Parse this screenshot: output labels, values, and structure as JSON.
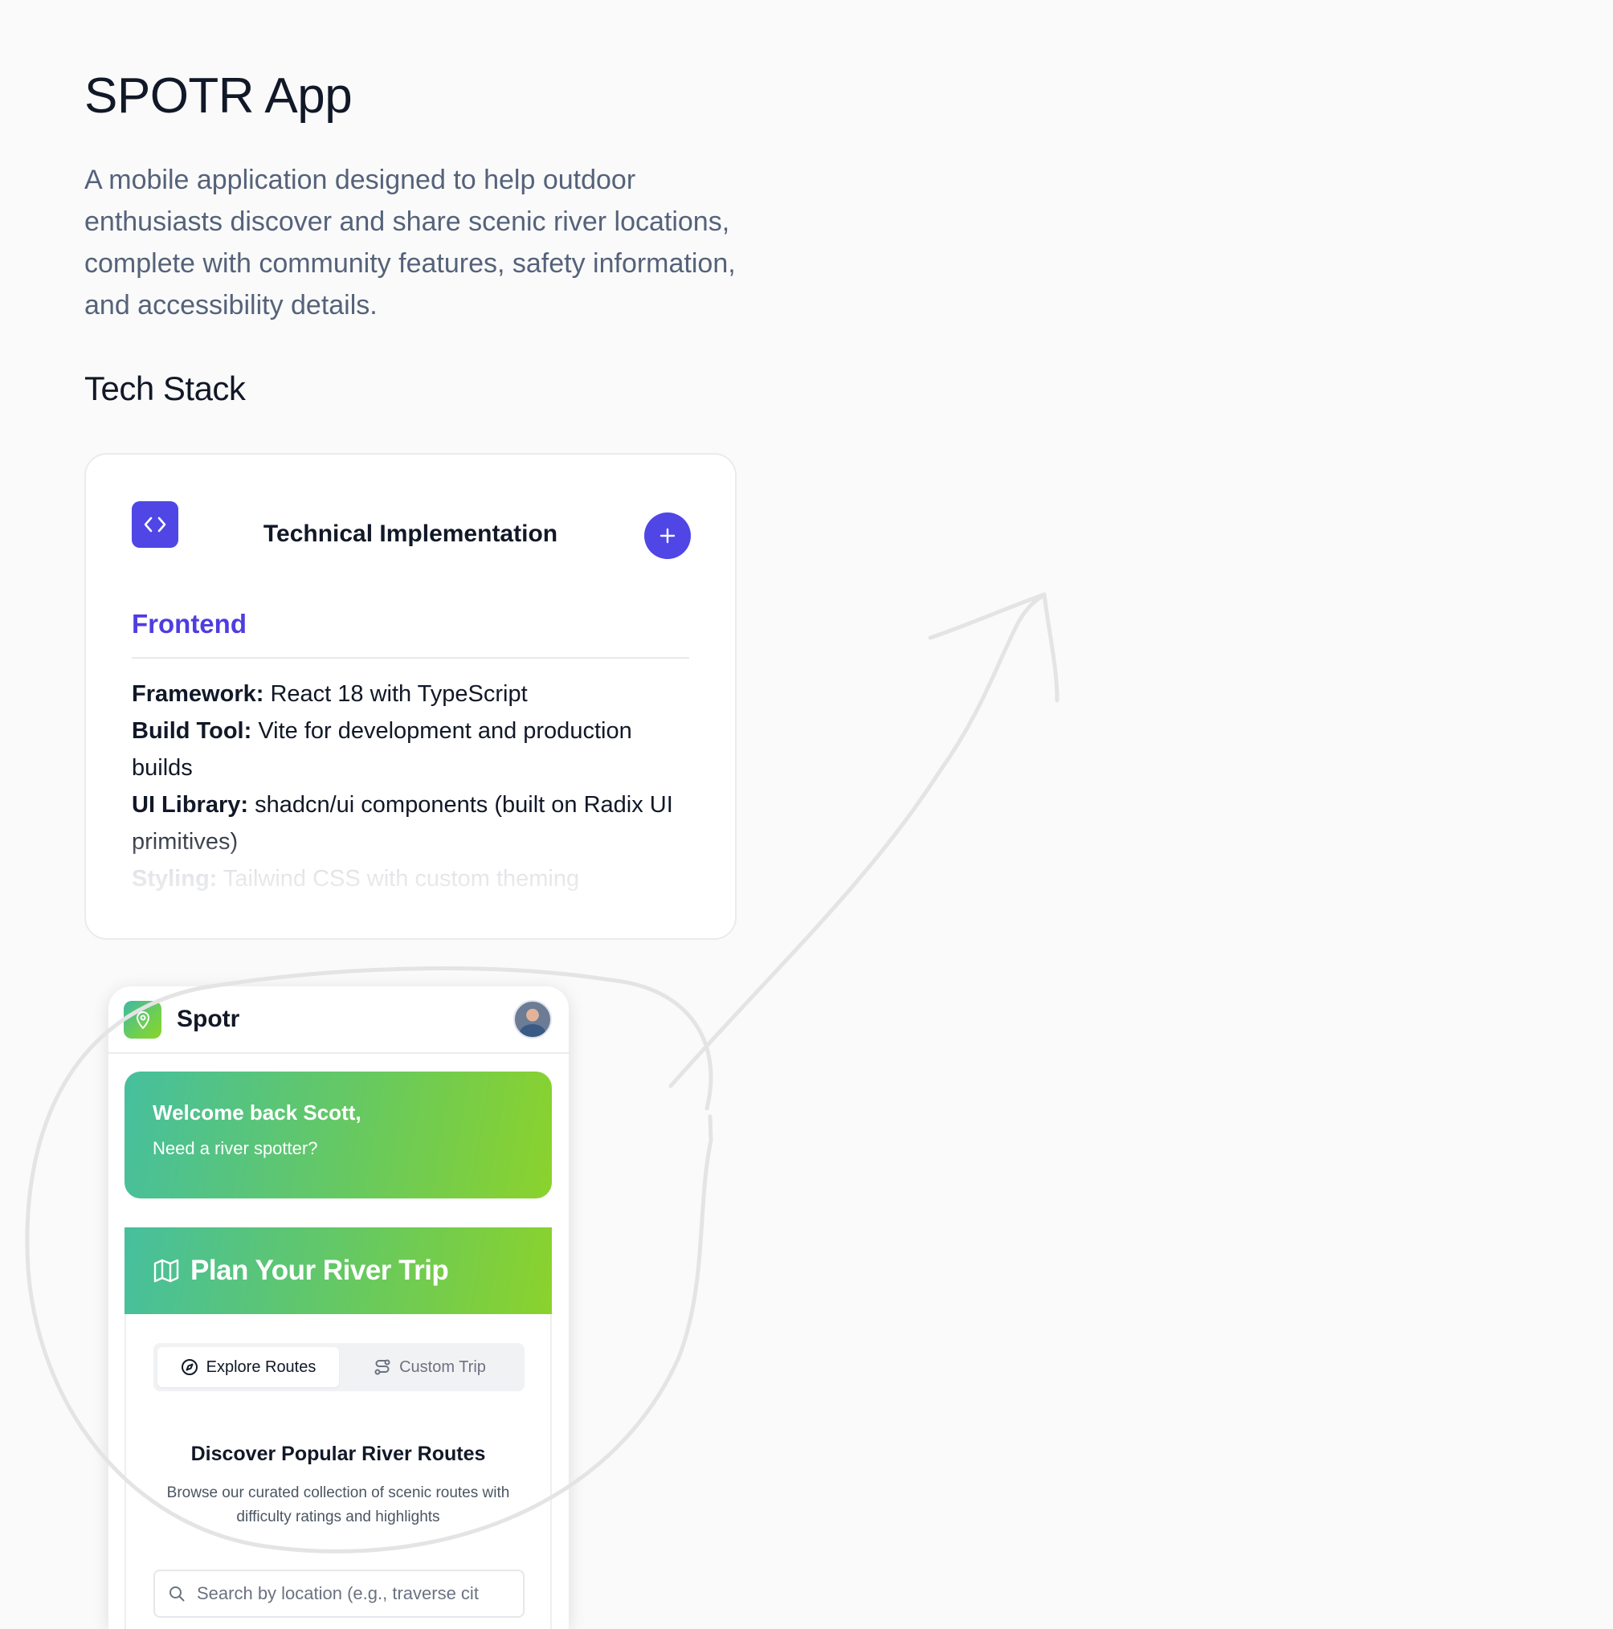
{
  "page": {
    "title": "SPOTR App",
    "intro": "A mobile application designed to help outdoor enthusiasts discover and share scenic river locations, complete with community features, safety information, and accessibility details.",
    "section_title": "Tech Stack"
  },
  "tech_card": {
    "icon": "code-icon",
    "title": "Technical Implementation",
    "expand_icon": "plus-icon",
    "frontend_heading": "Frontend",
    "items": [
      {
        "label": "Framework:",
        "value": "React 18 with TypeScript"
      },
      {
        "label": "Build Tool:",
        "value": "Vite for development and production builds"
      },
      {
        "label": "UI Library:",
        "value": "shadcn/ui components (built on Radix UI primitives)"
      },
      {
        "label": "Styling:",
        "value": "Tailwind CSS with custom theming"
      }
    ]
  },
  "app_preview": {
    "app_name": "Spotr",
    "logo_icon": "map-pin-icon",
    "welcome_title": "Welcome back Scott,",
    "welcome_sub": "Need a river spotter?",
    "plan_title": "Plan Your River Trip",
    "plan_icon": "map-icon",
    "tabs": [
      {
        "label": "Explore Routes",
        "icon": "compass-icon",
        "active": true
      },
      {
        "label": "Custom Trip",
        "icon": "route-icon",
        "active": false
      }
    ],
    "discover_title": "Discover Popular River Routes",
    "discover_desc": "Browse our curated collection of scenic routes with difficulty ratings and highlights",
    "search_placeholder": "Search by location (e.g., traverse cit"
  },
  "colors": {
    "accent": "#4f46e5",
    "frontend_heading": "#4f3de0",
    "gradient_start": "#46bf9e",
    "gradient_end": "#8bd22c",
    "annotation_stroke": "#e4e4e4"
  }
}
